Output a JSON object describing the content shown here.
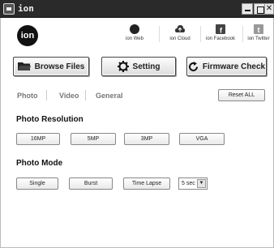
{
  "window": {
    "title": "ion"
  },
  "header": {
    "logo_text": "ion",
    "links": [
      {
        "label": "ion Web",
        "icon": "ion-web-icon"
      },
      {
        "label": "ion Cloud",
        "icon": "cloud-icon"
      },
      {
        "label": "ion Facebook",
        "icon": "facebook-icon"
      },
      {
        "label": "ion Twitter",
        "icon": "twitter-icon"
      }
    ]
  },
  "toolbar": {
    "browse_label": "Browse Files",
    "setting_label": "Setting",
    "firmware_label": "Firmware Check"
  },
  "tabs": {
    "photo": "Photo",
    "video": "Video",
    "general": "General",
    "reset": "Reset ALL"
  },
  "photo_resolution": {
    "title": "Photo Resolution",
    "options": [
      "16MP",
      "5MP",
      "3MP",
      "VGA"
    ]
  },
  "photo_mode": {
    "title": "Photo Mode",
    "options": [
      "Single",
      "Burst",
      "Time Lapse"
    ],
    "interval": "5 sec"
  },
  "colors": {
    "titlebar": "#2a2a2a",
    "text": "#222222",
    "tab_inactive": "#777777"
  }
}
